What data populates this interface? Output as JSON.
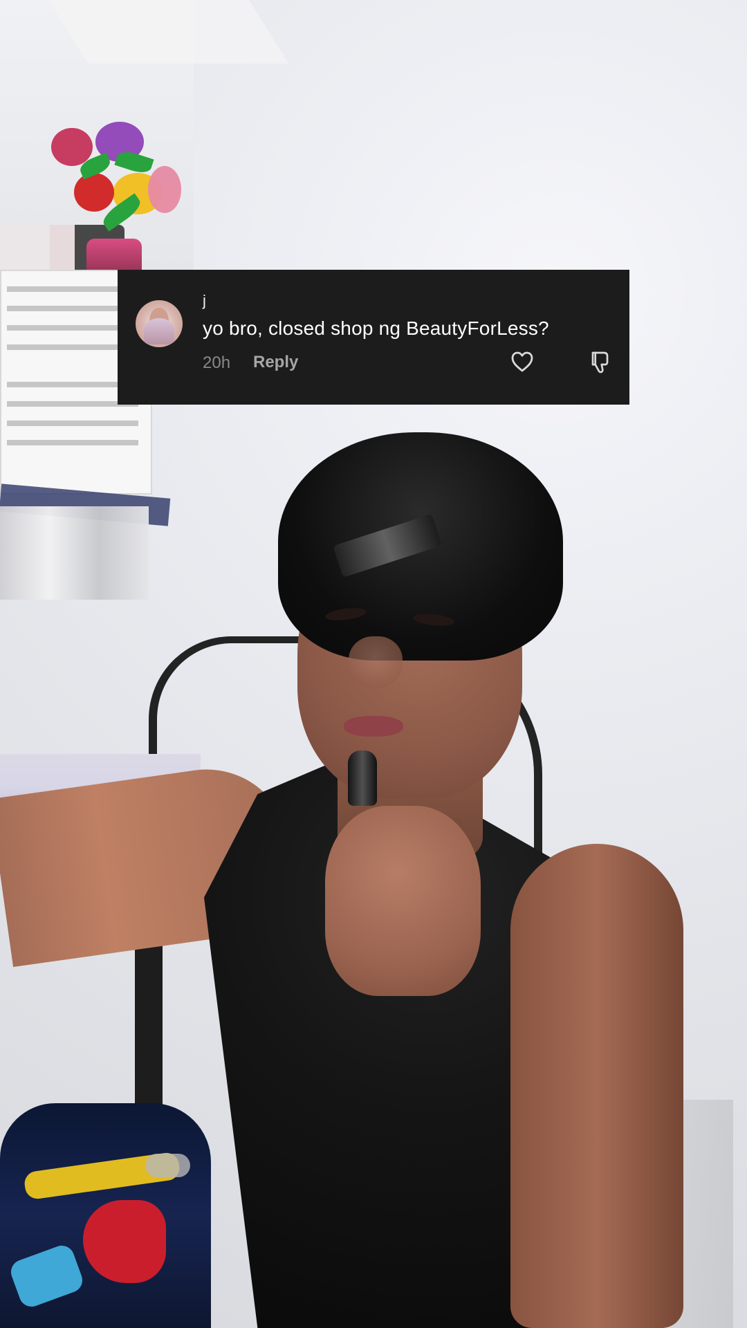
{
  "comment": {
    "username": "j",
    "text": "yo bro, closed shop ng BeautyForLess?",
    "time": "20h",
    "reply_label": "Reply"
  },
  "icons": {
    "like": "heart-icon",
    "dislike": "thumbs-down-icon"
  },
  "colors": {
    "comment_background": "#1c1c1d",
    "comment_text": "#ffffff",
    "secondary_text": "#8a8a8b"
  }
}
